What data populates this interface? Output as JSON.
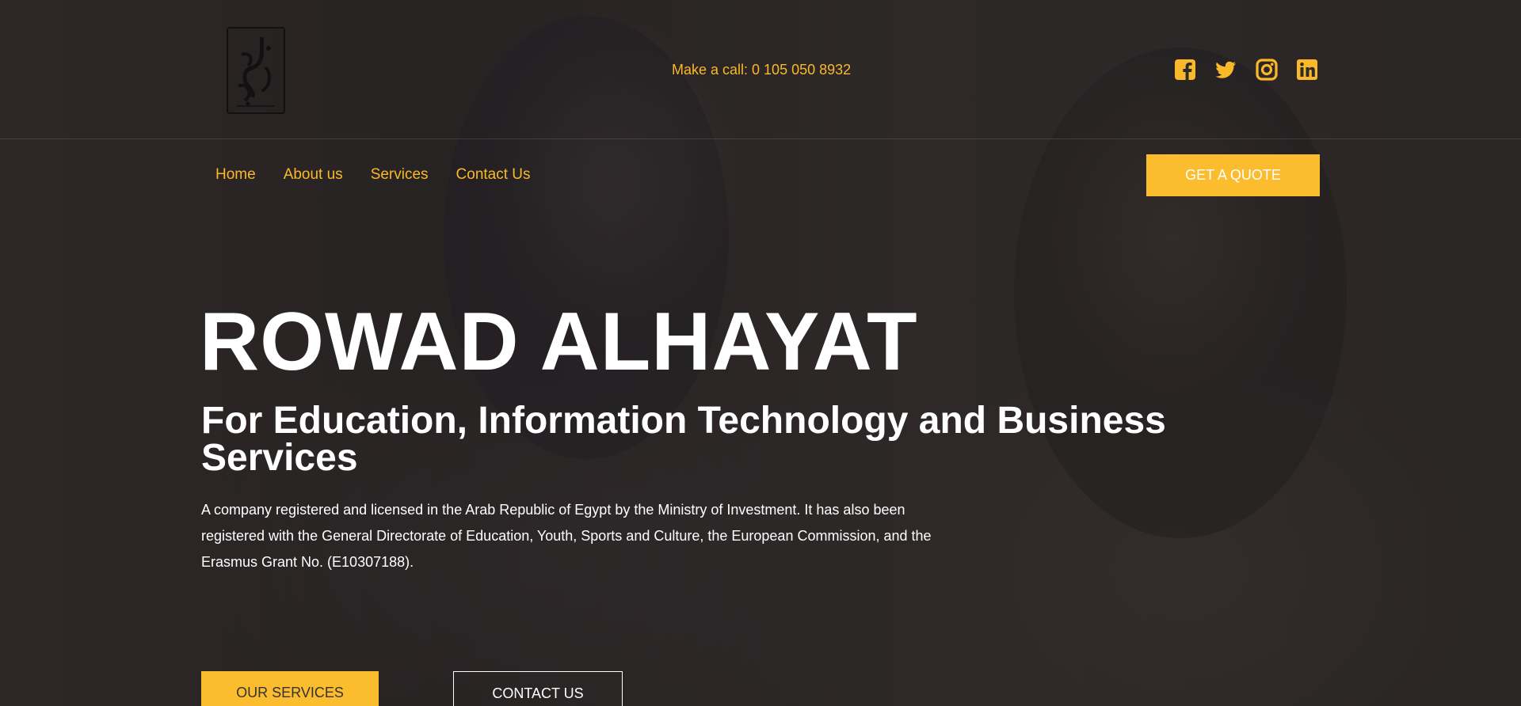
{
  "colors": {
    "accent": "#fbbd2e",
    "link": "#f9b928",
    "text": "#ffffff"
  },
  "header": {
    "logo_icon": "rowad-alhayat-calligraphy-logo",
    "phone_text": "Make a call: 0 105 050 8932",
    "social": [
      {
        "name": "facebook-icon"
      },
      {
        "name": "twitter-icon"
      },
      {
        "name": "instagram-icon"
      },
      {
        "name": "linkedin-icon"
      }
    ]
  },
  "nav": {
    "items": [
      "Home",
      "About us",
      "Services",
      "Contact Us"
    ],
    "quote_label": "GET A QUOTE"
  },
  "hero": {
    "title": "ROWAD ALHAYAT",
    "subtitle": "For Education, Information Technology and Business Services",
    "description": "A company registered and licensed in the Arab Republic of Egypt by the Ministry of Investment. It has also been registered with the General Directorate of Education, Youth, Sports and Culture, the European Commission, and the Erasmus Grant No. (E10307188).",
    "services_label": "OUR SERVICES",
    "contact_label": "CONTACT US"
  }
}
